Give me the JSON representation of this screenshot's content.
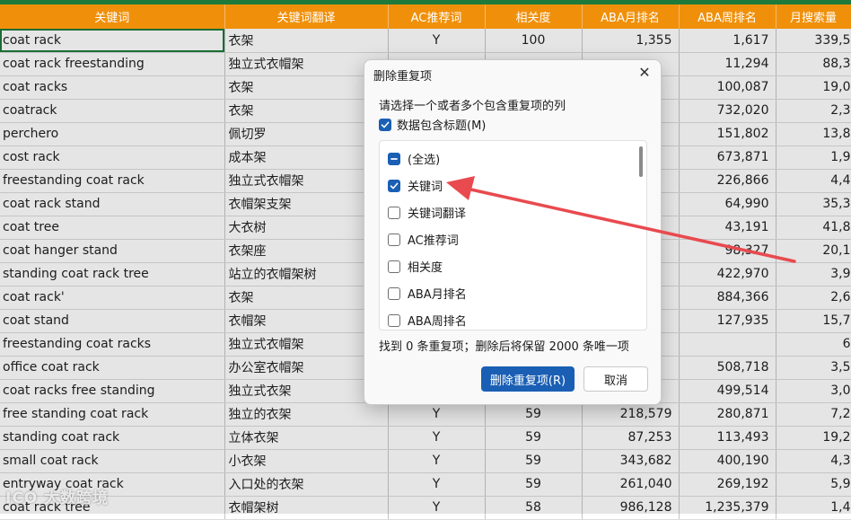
{
  "sheet": {
    "headers": [
      "关键词",
      "关键词翻译",
      "AC推荐词",
      "相关度",
      "ABA月排名",
      "ABA周排名",
      "月搜索量"
    ],
    "rows": [
      [
        "coat rack",
        "衣架",
        "Y",
        "100",
        "1,355",
        "1,617",
        "339,5"
      ],
      [
        "coat rack freestanding",
        "独立式衣帽架",
        "",
        "",
        "",
        "11,294",
        "88,3"
      ],
      [
        "coat racks",
        "衣架",
        "",
        "",
        "",
        "100,087",
        "19,0"
      ],
      [
        "coatrack",
        "衣架",
        "",
        "",
        "",
        "732,020",
        "2,3"
      ],
      [
        "perchero",
        "佩切罗",
        "",
        "",
        "",
        "151,802",
        "13,8"
      ],
      [
        "cost rack",
        "成本架",
        "",
        "",
        "",
        "673,871",
        "1,9"
      ],
      [
        "freestanding coat rack",
        "独立式衣帽架",
        "",
        "",
        "",
        "226,866",
        "4,4"
      ],
      [
        "coat rack stand",
        "衣帽架支架",
        "",
        "",
        "",
        "64,990",
        "35,3"
      ],
      [
        "coat tree",
        "大衣树",
        "",
        "",
        "",
        "43,191",
        "41,8"
      ],
      [
        "coat hanger stand",
        "衣架座",
        "",
        "",
        "",
        "98,327",
        "20,1"
      ],
      [
        "standing coat rack tree",
        "站立的衣帽架树",
        "",
        "",
        "",
        "422,970",
        "3,9"
      ],
      [
        "coat rack'",
        "衣架",
        "",
        "",
        "",
        "884,366",
        "2,6"
      ],
      [
        "coat stand",
        "衣帽架",
        "",
        "",
        "",
        "127,935",
        "15,7"
      ],
      [
        "freestanding coat racks",
        "独立式衣帽架",
        "",
        "",
        "",
        "",
        "6"
      ],
      [
        "office coat rack",
        "办公室衣帽架",
        "",
        "",
        "",
        "508,718",
        "3,5"
      ],
      [
        "coat racks free standing",
        "独立式衣架",
        "",
        "",
        "",
        "499,514",
        "3,0"
      ],
      [
        "free standing coat rack",
        "独立的衣架",
        "Y",
        "59",
        "218,579",
        "280,871",
        "7,2"
      ],
      [
        "standing coat rack",
        "立体衣架",
        "Y",
        "59",
        "87,253",
        "113,493",
        "19,2"
      ],
      [
        "small coat rack",
        "小衣架",
        "Y",
        "59",
        "343,682",
        "400,190",
        "4,3"
      ],
      [
        "entryway coat rack",
        "入口处的衣架",
        "Y",
        "59",
        "261,040",
        "269,192",
        "5,9"
      ],
      [
        "coat rack tree",
        "衣帽架树",
        "Y",
        "58",
        "986,128",
        "1,235,379",
        "1,4"
      ]
    ]
  },
  "dialog": {
    "title": "删除重复项",
    "close_glyph": "✕",
    "prompt": "请选择一个或者多个包含重复项的列",
    "header_option": {
      "label": "数据包含标题(M)",
      "checked": true
    },
    "columns": [
      {
        "label": "(全选)",
        "state": "indeterminate"
      },
      {
        "label": "关键词",
        "state": "checked"
      },
      {
        "label": "关键词翻译",
        "state": "unchecked"
      },
      {
        "label": "AC推荐词",
        "state": "unchecked"
      },
      {
        "label": "相关度",
        "state": "unchecked"
      },
      {
        "label": "ABA月排名",
        "state": "unchecked"
      },
      {
        "label": "ABA周排名",
        "state": "unchecked"
      }
    ],
    "status": "找到 0 条重复项；删除后将保留 2000 条唯一项",
    "confirm_label": "删除重复项(R)",
    "cancel_label": "取消"
  },
  "watermark": "ICO 大数跨境",
  "colors": {
    "header_bg": "#f0900a",
    "accent": "#1a5fb4",
    "arrow": "#e84a4f",
    "selection": "#1e7a3a"
  }
}
